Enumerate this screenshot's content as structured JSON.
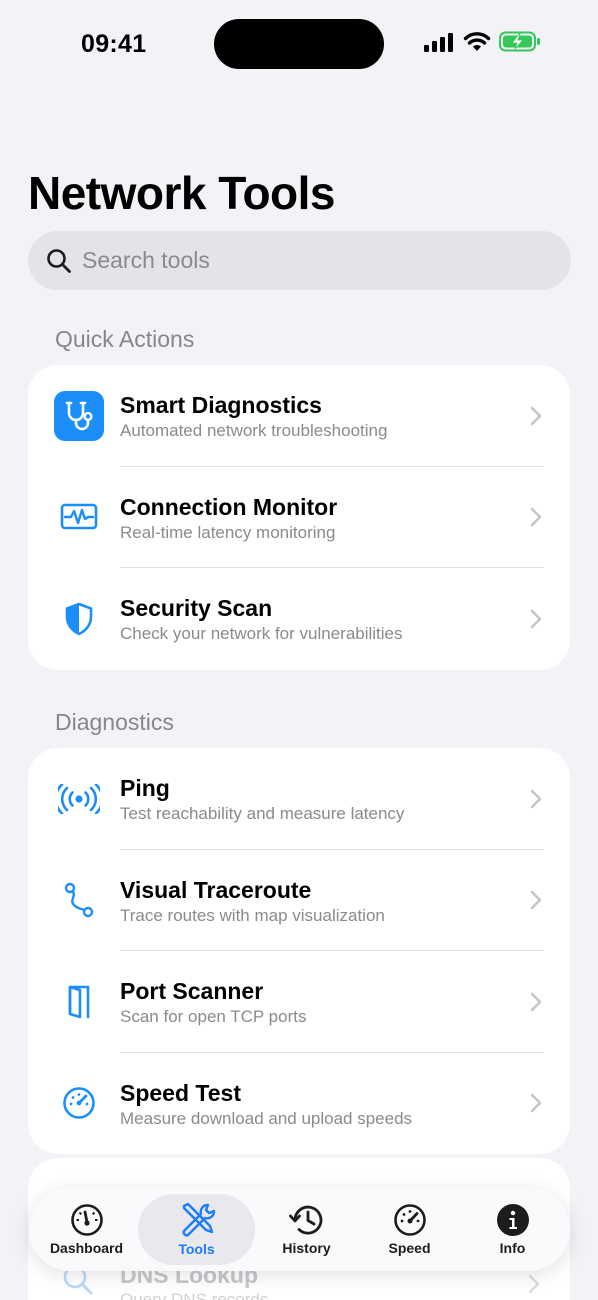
{
  "status_bar": {
    "time": "09:41"
  },
  "page": {
    "title": "Network Tools"
  },
  "search": {
    "placeholder": "Search tools"
  },
  "sections": {
    "quick_actions": {
      "header": "Quick Actions",
      "items": [
        {
          "title": "Smart Diagnostics",
          "subtitle": "Automated network troubleshooting",
          "icon": "stethoscope-icon"
        },
        {
          "title": "Connection Monitor",
          "subtitle": "Real-time latency monitoring",
          "icon": "waveform-monitor-icon"
        },
        {
          "title": "Security Scan",
          "subtitle": "Check your network for vulnerabilities",
          "icon": "shield-icon"
        }
      ]
    },
    "diagnostics": {
      "header": "Diagnostics",
      "items": [
        {
          "title": "Ping",
          "subtitle": "Test reachability and measure latency",
          "icon": "broadcast-icon"
        },
        {
          "title": "Visual Traceroute",
          "subtitle": "Trace routes with map visualization",
          "icon": "route-icon"
        },
        {
          "title": "Port Scanner",
          "subtitle": "Scan for open TCP ports",
          "icon": "door-icon"
        },
        {
          "title": "Speed Test",
          "subtitle": "Measure download and upload speeds",
          "icon": "gauge-icon"
        },
        {
          "title": "DNS Lookup",
          "subtitle": "Query DNS records",
          "icon": "magnifier-icon"
        }
      ]
    }
  },
  "tabbar": {
    "tabs": [
      {
        "label": "Dashboard",
        "icon": "gauge-icon"
      },
      {
        "label": "Tools",
        "icon": "wrench-screwdriver-icon"
      },
      {
        "label": "History",
        "icon": "history-clock-icon"
      },
      {
        "label": "Speed",
        "icon": "speedometer-icon"
      },
      {
        "label": "Info",
        "icon": "info-icon"
      }
    ],
    "active_index": 1
  },
  "colors": {
    "accent": "#1c8ef9",
    "background": "#f2f2f7",
    "secondary_text": "#8a8a8f"
  }
}
